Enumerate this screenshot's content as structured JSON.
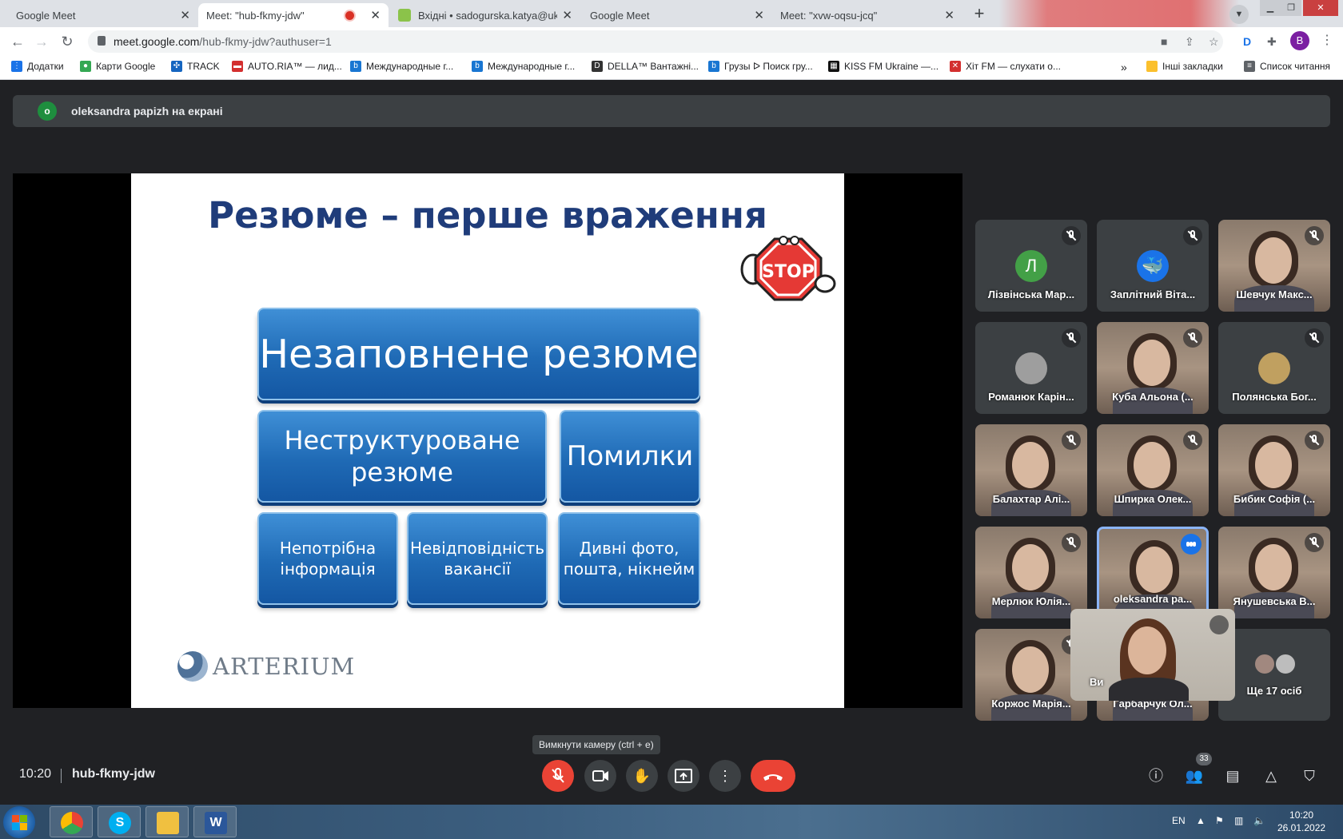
{
  "browser": {
    "tabs": [
      {
        "title": "Google Meet",
        "icon": "meet-icon"
      },
      {
        "title": "Meet: \"hub-fkmy-jdw\"",
        "icon": "meet-icon",
        "recording": true
      },
      {
        "title": "Вхідні • sadogurska.katya@ukr.n",
        "icon": "mail-icon"
      },
      {
        "title": "Google Meet",
        "icon": "meet-icon"
      },
      {
        "title": "Meet: \"xvw-oqsu-jcq\"",
        "icon": "meet-icon"
      }
    ],
    "url_main": "meet.google.com",
    "url_path": "/hub-fkmy-jdw?authuser=1",
    "profile_initial": "B",
    "bookmarks": [
      "Додатки",
      "Карти Google",
      "TRACK",
      "AUTO.RIA™ — лид...",
      "Международные г...",
      "Международные г...",
      "DELLA™ Вантажні...",
      "Грузы ᐅ Поиск гру...",
      "KISS FM Ukraine —...",
      "Хіт FM — слухати о..."
    ],
    "more_bookmarks": "»",
    "other_bookmarks": "Інші закладки",
    "reading_list": "Список читання"
  },
  "meet": {
    "presenter_initial": "o",
    "presenter_banner": "oleksandra papizh на екрані",
    "slide": {
      "title": "Резюме – перше враження",
      "stop_sign": "STOP",
      "box_top": "Незаповнене резюме",
      "box_mid_left_1": "Неструктуроване",
      "box_mid_left_2": "резюме",
      "box_mid_right": "Помилки",
      "box_bot_1_a": "Непотрібна",
      "box_bot_1_b": "інформація",
      "box_bot_2_a": "Невідповідність",
      "box_bot_2_b": "вакансії",
      "box_bot_3_a": "Дивні фото,",
      "box_bot_3_b": "пошта, нікнейм",
      "logo": "ARTERIUM"
    },
    "participants": [
      {
        "name": "Лізвінська Мар...",
        "avatar": "Л",
        "avatar_color": "#43a047"
      },
      {
        "name": "Заплітний Віта...",
        "avatar": "🐳",
        "avatar_color": "#1a73e8"
      },
      {
        "name": "Шевчук Макс...",
        "camera": true
      },
      {
        "name": "Романюк Карін...",
        "avatar": "",
        "avatar_color": "#9e9e9e"
      },
      {
        "name": "Куба Альона (...",
        "camera": true
      },
      {
        "name": "Полянська Бог...",
        "avatar": "",
        "avatar_color": "#c0a060"
      },
      {
        "name": "Балахтар Алі...",
        "camera": true
      },
      {
        "name": "Шпирка Олек...",
        "camera": true
      },
      {
        "name": "Бибик Софія (...",
        "camera": true
      },
      {
        "name": "Мерлюк Юлія...",
        "camera": true
      },
      {
        "name": "oleksandra pa...",
        "camera": true,
        "speaking": true
      },
      {
        "name": "Янушевська В...",
        "camera": true
      },
      {
        "name": "Коржос Марія...",
        "camera": true
      },
      {
        "name": "Гарбарчук Ол...",
        "camera": true
      }
    ],
    "more_label": "Ще 17 осіб",
    "self_label": "Ви",
    "tooltip": "Вимкнути камеру (ctrl + e)",
    "time": "10:20",
    "meeting_code": "hub-fkmy-jdw",
    "people_count": "33"
  },
  "taskbar": {
    "lang": "EN",
    "time": "10:20",
    "date": "26.01.2022"
  }
}
